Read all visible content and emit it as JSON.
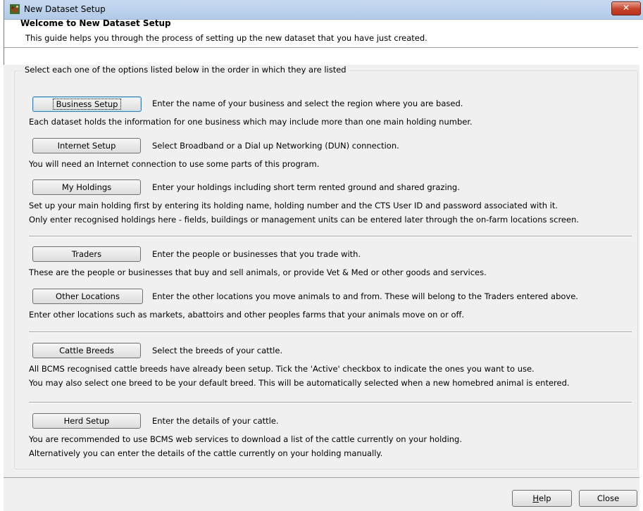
{
  "window": {
    "title": "New Dataset Setup",
    "close_glyph": "✕"
  },
  "header": {
    "title": "Welcome to New Dataset Setup",
    "subtitle": "This guide helps you through the process of setting up the new dataset that you have just created."
  },
  "group": {
    "legend": "Select each one of the options listed below in the order in which they are listed"
  },
  "steps": [
    {
      "button": "Business Setup",
      "description": "Enter the name of your business and select the region where you are based.",
      "notes": [
        "Each dataset holds the information for one business which may include more than one main holding number."
      ]
    },
    {
      "button": "Internet Setup",
      "description": "Select Broadband or a Dial up Networking (DUN) connection.",
      "notes": [
        "You will need an Internet connection to use some parts of this program."
      ]
    },
    {
      "button": "My Holdings",
      "description": "Enter your holdings including short term rented ground and shared grazing.",
      "notes": [
        "Set up your main holding first by entering its holding name, holding number and the CTS User ID and password associated with it.",
        "Only enter recognised holdings here - fields, buildings or management units can be entered later through the on-farm locations screen."
      ]
    },
    {
      "button": "Traders",
      "description": "Enter the people or businesses that you trade with.",
      "notes": [
        "These are the people or businesses that buy and sell animals, or provide Vet & Med or other goods and services."
      ]
    },
    {
      "button": "Other Locations",
      "description": "Enter the other locations you move animals to and from. These will belong to the Traders entered above.",
      "notes": [
        "Enter other locations such as markets, abattoirs and other peoples farms that your animals move on or off."
      ]
    },
    {
      "button": "Cattle Breeds",
      "description": "Select the breeds of your cattle.",
      "notes": [
        "All BCMS recognised cattle breeds have already been setup. Tick the 'Active' checkbox to indicate the ones you want to use.",
        "You may also select one breed to be your default breed. This will be automatically selected when a new homebred animal is entered."
      ]
    },
    {
      "button": "Herd Setup",
      "description": "Enter the details of your cattle.",
      "notes": [
        "You are recommended to use BCMS web services to download a list of the cattle currently on your holding.",
        "Alternatively you can enter the details of the cattle currently on your holding manually."
      ]
    }
  ],
  "footer": {
    "help_mnemonic": "H",
    "help_rest": "elp",
    "close_label": "Close"
  },
  "icons": {
    "app": "cattle-app-icon",
    "close": "close-icon"
  }
}
